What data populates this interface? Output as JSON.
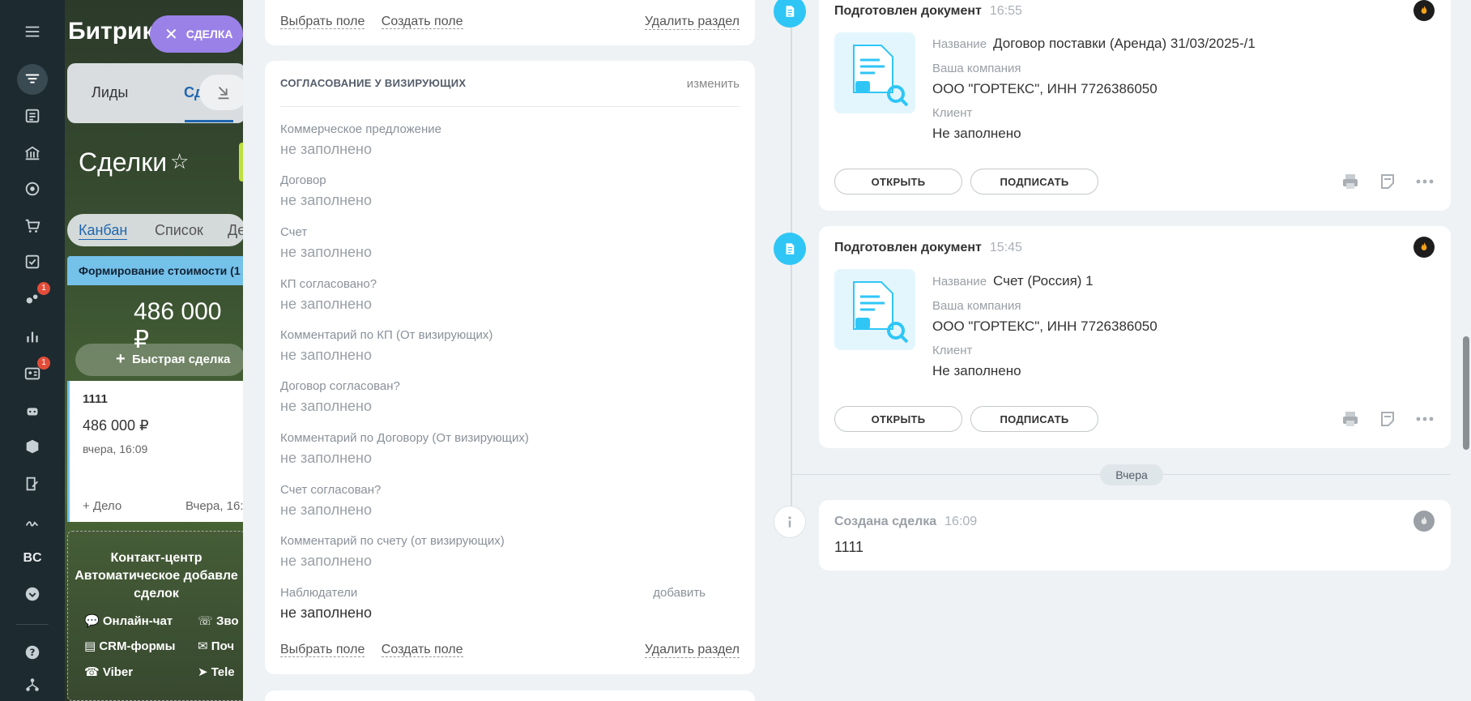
{
  "nav": {
    "badges": [
      "1",
      "1"
    ],
    "text_icon": "BC"
  },
  "background": {
    "app_title": "Битрик",
    "deal_pill": "СДЕЛКА",
    "tab_leads": "Лиды",
    "tab_deals": "Сд",
    "page_title": "Сделки",
    "views": [
      "Канбан",
      "Список",
      "Де"
    ],
    "column_title": "Формирование стоимости (1",
    "column_sum": "486 000 ₽",
    "quick_deal": "Быстрая сделка",
    "card": {
      "title": "1111",
      "sum": "486 000 ₽",
      "date": "вчера, 16:09",
      "add_task": "+ Дело",
      "date2": "Вчера, 16:"
    },
    "contact_center": {
      "title": "Контакт-центр",
      "line1": "Автоматическое добавле",
      "line2": "сделок",
      "items": [
        "Онлайн-чат",
        "Зво",
        "CRM-формы",
        "Поч",
        "Viber",
        "Tele"
      ]
    }
  },
  "top_section": {
    "select_field": "Выбрать поле",
    "create_field": "Создать поле",
    "delete_section": "Удалить раздел"
  },
  "approval_section": {
    "title": "СОГЛАСОВАНИЕ У ВИЗИРУЮЩИХ",
    "edit": "изменить",
    "fields": [
      {
        "label": "Коммерческое предложение",
        "value": "не заполнено"
      },
      {
        "label": "Договор",
        "value": "не заполнено"
      },
      {
        "label": "Счет",
        "value": "не заполнено"
      },
      {
        "label": "КП согласовано?",
        "value": "не заполнено"
      },
      {
        "label": "Комментарий по КП (От визирующих)",
        "value": "не заполнено"
      },
      {
        "label": "Договор согласован?",
        "value": "не заполнено"
      },
      {
        "label": "Комментарий по Договору (От визирующих)",
        "value": "не заполнено"
      },
      {
        "label": "Счет согласован?",
        "value": "не заполнено"
      },
      {
        "label": "Комментарий по счету (от визирующих)",
        "value": "не заполнено"
      }
    ],
    "observers": {
      "label": "Наблюдатели",
      "add": "добавить",
      "value": "не заполнено"
    },
    "select_field": "Выбрать поле",
    "create_field": "Создать поле",
    "delete_section": "Удалить раздел"
  },
  "timeline": {
    "doc1": {
      "header": "Подготовлен документ",
      "time": "16:55",
      "name_label": "Название",
      "name_value": "Договор поставки (Аренда) 31/03/2025-/1",
      "company_label": "Ваша компания",
      "company_value": "ООО \"ГОРТЕКС\", ИНН 7726386050",
      "client_label": "Клиент",
      "client_value": "Не заполнено",
      "open": "ОТКРЫТЬ",
      "sign": "ПОДПИСАТЬ"
    },
    "doc2": {
      "header": "Подготовлен документ",
      "time": "15:45",
      "name_label": "Название",
      "name_value": "Счет (Россия) 1",
      "company_label": "Ваша компания",
      "company_value": "ООО \"ГОРТЕКС\", ИНН 7726386050",
      "client_label": "Клиент",
      "client_value": "Не заполнено",
      "open": "ОТКРЫТЬ",
      "sign": "ПОДПИСАТЬ"
    },
    "divider": "Вчера",
    "created": {
      "header": "Создана сделка",
      "time": "16:09",
      "value": "1111"
    }
  }
}
